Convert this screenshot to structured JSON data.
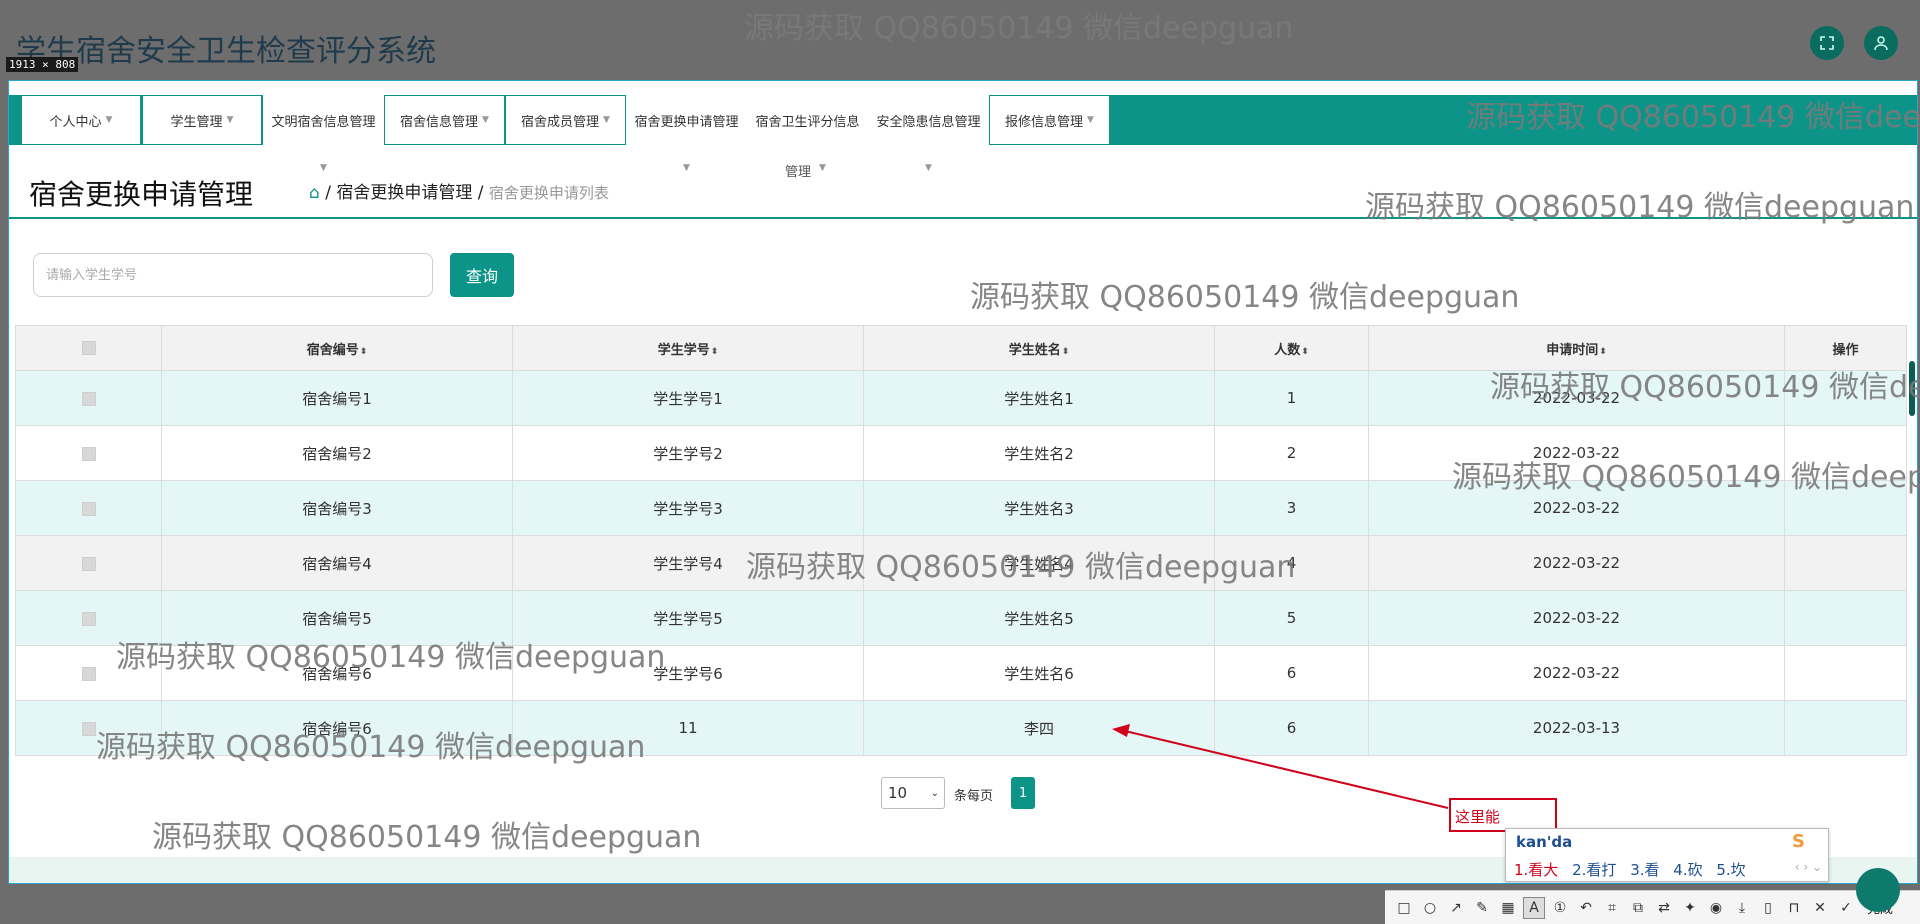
{
  "app": {
    "title": "学生宿舍安全卫生检查评分系统"
  },
  "capture": {
    "size_label": "1913 × 808"
  },
  "nav": [
    {
      "label": "个人中心"
    },
    {
      "label": "学生管理"
    },
    {
      "label": "文明宿舍信息管理"
    },
    {
      "label": "宿舍信息管理"
    },
    {
      "label": "宿舍成员管理"
    },
    {
      "label": "宿舍更换申请管理"
    },
    {
      "label": "宿舍卫生评分信息"
    },
    {
      "label": "安全隐患信息管理"
    },
    {
      "label": "报修信息管理"
    }
  ],
  "nav_wrap_text": "管理",
  "page": {
    "title": "宿舍更换申请管理",
    "breadcrumb_section": "宿舍更换申请管理",
    "breadcrumb_current": "宿舍更换申请列表"
  },
  "search": {
    "placeholder": "请输入学生学号",
    "button": "查询"
  },
  "table": {
    "columns": [
      "宿舍编号",
      "学生学号",
      "学生姓名",
      "人数",
      "申请时间",
      "操作"
    ],
    "rows": [
      {
        "dorm": "宿舍编号1",
        "sid": "学生学号1",
        "name": "学生姓名1",
        "count": "1",
        "date": "2022-03-22"
      },
      {
        "dorm": "宿舍编号2",
        "sid": "学生学号2",
        "name": "学生姓名2",
        "count": "2",
        "date": "2022-03-22"
      },
      {
        "dorm": "宿舍编号3",
        "sid": "学生学号3",
        "name": "学生姓名3",
        "count": "3",
        "date": "2022-03-22"
      },
      {
        "dorm": "宿舍编号4",
        "sid": "学生学号4",
        "name": "学生姓名4",
        "count": "4",
        "date": "2022-03-22"
      },
      {
        "dorm": "宿舍编号5",
        "sid": "学生学号5",
        "name": "学生姓名5",
        "count": "5",
        "date": "2022-03-22"
      },
      {
        "dorm": "宿舍编号6",
        "sid": "学生学号6",
        "name": "学生姓名6",
        "count": "6",
        "date": "2022-03-22"
      },
      {
        "dorm": "宿舍编号6",
        "sid": "11",
        "name": "李四",
        "count": "6",
        "date": "2022-03-13"
      }
    ]
  },
  "pagination": {
    "page_size": "10",
    "per_page_label": "条每页",
    "current_page": "1"
  },
  "annotation": {
    "text": "这里能"
  },
  "ime": {
    "composition": "kan'da",
    "candidates": [
      "1.看大",
      "2.看打",
      "3.看",
      "4.砍",
      "5.坎"
    ]
  },
  "toolbar": {
    "done_label": "完成"
  },
  "watermark": "源码获取 QQ86050149 微信deepguan",
  "colors": {
    "accent": "#0d9488",
    "row_alt": "#e4f6f5",
    "annotation": "#d0021b"
  },
  "icons": {
    "fullscreen": "fullscreen-icon",
    "user": "user-icon",
    "sort": "sort-icon",
    "caret": "caret-down-icon"
  }
}
